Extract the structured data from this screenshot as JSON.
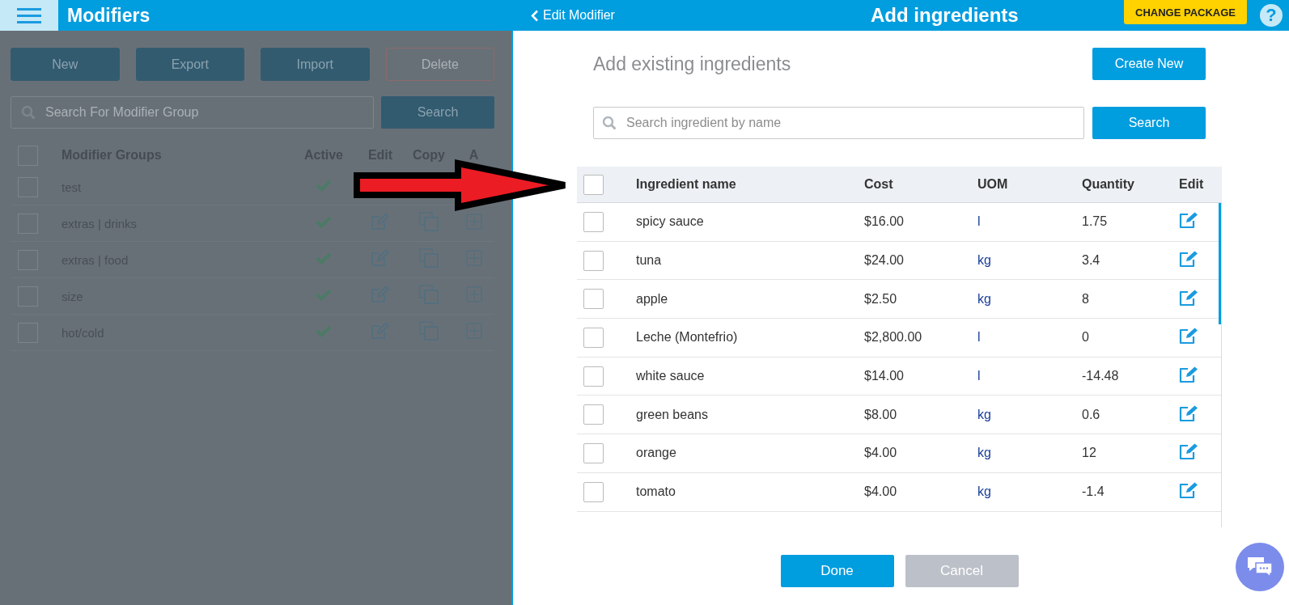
{
  "header": {
    "title": "Modifiers",
    "back_link": "Edit Modifier",
    "page_title": "Add ingredients",
    "package_button": "CHANGE PACKAGE",
    "help": "?"
  },
  "background_panel": {
    "buttons": [
      {
        "label": "New",
        "kind": "solid"
      },
      {
        "label": "Export",
        "kind": "solid"
      },
      {
        "label": "Import",
        "kind": "solid"
      },
      {
        "label": "Delete",
        "kind": "outline"
      }
    ],
    "search": {
      "placeholder": "Search For Modifier Group",
      "button": "Search"
    },
    "table": {
      "select_all": {
        "checked": false
      },
      "columns": [
        "Modifier Groups",
        "Active",
        "Edit",
        "Copy",
        "A"
      ],
      "rows": [
        {
          "name": "test",
          "checked": false,
          "active": true
        },
        {
          "name": "extras | drinks",
          "checked": false,
          "active": true
        },
        {
          "name": "extras | food",
          "checked": false,
          "active": true
        },
        {
          "name": "size",
          "checked": false,
          "active": true
        },
        {
          "name": "hot/cold",
          "checked": false,
          "active": true
        }
      ]
    }
  },
  "modal": {
    "heading": "Add existing ingredients",
    "create_button": "Create New",
    "search": {
      "placeholder": "Search ingredient by name",
      "button": "Search"
    },
    "table": {
      "select_all": {
        "checked": false
      },
      "columns": [
        "Ingredient name",
        "Cost",
        "UOM",
        "Quantity",
        "Edit"
      ],
      "rows": [
        {
          "name": "spicy sauce",
          "cost": "$16.00",
          "uom": "l",
          "quantity": "1.75",
          "checked": false
        },
        {
          "name": "tuna",
          "cost": "$24.00",
          "uom": "kg",
          "quantity": "3.4",
          "checked": false
        },
        {
          "name": "apple",
          "cost": "$2.50",
          "uom": "kg",
          "quantity": "8",
          "checked": false
        },
        {
          "name": "Leche (Montefrio)",
          "cost": "$2,800.00",
          "uom": "l",
          "quantity": "0",
          "checked": false
        },
        {
          "name": "white sauce",
          "cost": "$14.00",
          "uom": "l",
          "quantity": "-14.48",
          "checked": false
        },
        {
          "name": "green beans",
          "cost": "$8.00",
          "uom": "kg",
          "quantity": "0.6",
          "checked": false
        },
        {
          "name": "orange",
          "cost": "$4.00",
          "uom": "kg",
          "quantity": "12",
          "checked": false
        },
        {
          "name": "tomato",
          "cost": "$4.00",
          "uom": "kg",
          "quantity": "-1.4",
          "checked": false
        }
      ]
    },
    "buttons": [
      {
        "label": "Done",
        "kind": "primary"
      },
      {
        "label": "Cancel",
        "kind": "disabled"
      }
    ]
  }
}
